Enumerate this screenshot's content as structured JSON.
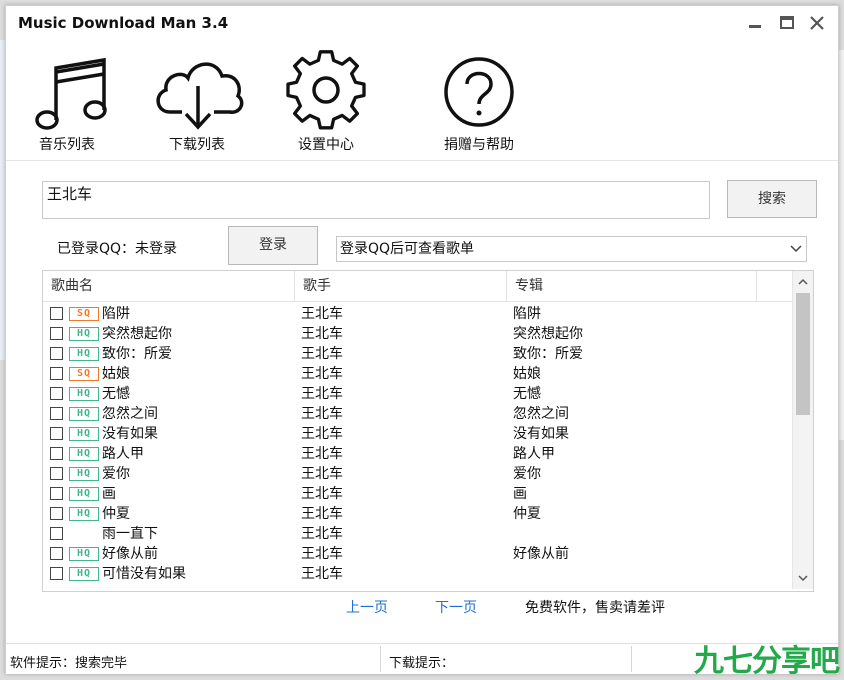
{
  "window": {
    "title": "Music Download Man 3.4",
    "controls": [
      "minimize-icon",
      "maximize-icon",
      "close-icon"
    ]
  },
  "toolbar": [
    {
      "label": "音乐列表",
      "icon": "music-note-icon"
    },
    {
      "label": "下载列表",
      "icon": "cloud-download-icon"
    },
    {
      "label": "设置中心",
      "icon": "gear-icon"
    },
    {
      "label": "捐赠与帮助",
      "icon": "help-icon"
    }
  ],
  "search": {
    "value": "王北车",
    "button_label": "搜索"
  },
  "qq": {
    "status_label": "已登录QQ：未登录",
    "login_button": "登录",
    "playlist_select": "登录QQ后可查看歌单"
  },
  "table": {
    "headers": [
      "歌曲名",
      "歌手",
      "专辑"
    ],
    "rows": [
      {
        "quality": "SQ",
        "song": "陷阱",
        "artist": "王北车",
        "album": "陷阱"
      },
      {
        "quality": "HQ",
        "song": "突然想起你",
        "artist": "王北车",
        "album": "突然想起你"
      },
      {
        "quality": "HQ",
        "song": "致你：所爱",
        "artist": "王北车",
        "album": "致你：所爱"
      },
      {
        "quality": "SQ",
        "song": "姑娘",
        "artist": "王北车",
        "album": "姑娘"
      },
      {
        "quality": "HQ",
        "song": "无憾",
        "artist": "王北车",
        "album": "无憾"
      },
      {
        "quality": "HQ",
        "song": "忽然之间",
        "artist": "王北车",
        "album": "忽然之间"
      },
      {
        "quality": "HQ",
        "song": "没有如果",
        "artist": "王北车",
        "album": "没有如果"
      },
      {
        "quality": "HQ",
        "song": "路人甲",
        "artist": "王北车",
        "album": "路人甲"
      },
      {
        "quality": "HQ",
        "song": "爱你",
        "artist": "王北车",
        "album": "爱你"
      },
      {
        "quality": "HQ",
        "song": "画",
        "artist": "王北车",
        "album": "画"
      },
      {
        "quality": "HQ",
        "song": "仲夏",
        "artist": "王北车",
        "album": "仲夏"
      },
      {
        "quality": "",
        "song": "雨一直下",
        "artist": "王北车",
        "album": ""
      },
      {
        "quality": "HQ",
        "song": "好像从前",
        "artist": "王北车",
        "album": "好像从前"
      },
      {
        "quality": "HQ",
        "song": "可惜没有如果",
        "artist": "王北车",
        "album": ""
      }
    ]
  },
  "pager": {
    "prev": "上一页",
    "next": "下一页",
    "note": "免费软件，售卖请差评"
  },
  "status": {
    "software_hint": "软件提示：搜索完毕",
    "download_hint": "下载提示："
  },
  "watermark": "九七分享吧",
  "colors": {
    "hq_badge": "#3fb98a",
    "sq_badge": "#f07a2a",
    "link": "#1e6fd6",
    "watermark": "#23a84a"
  }
}
